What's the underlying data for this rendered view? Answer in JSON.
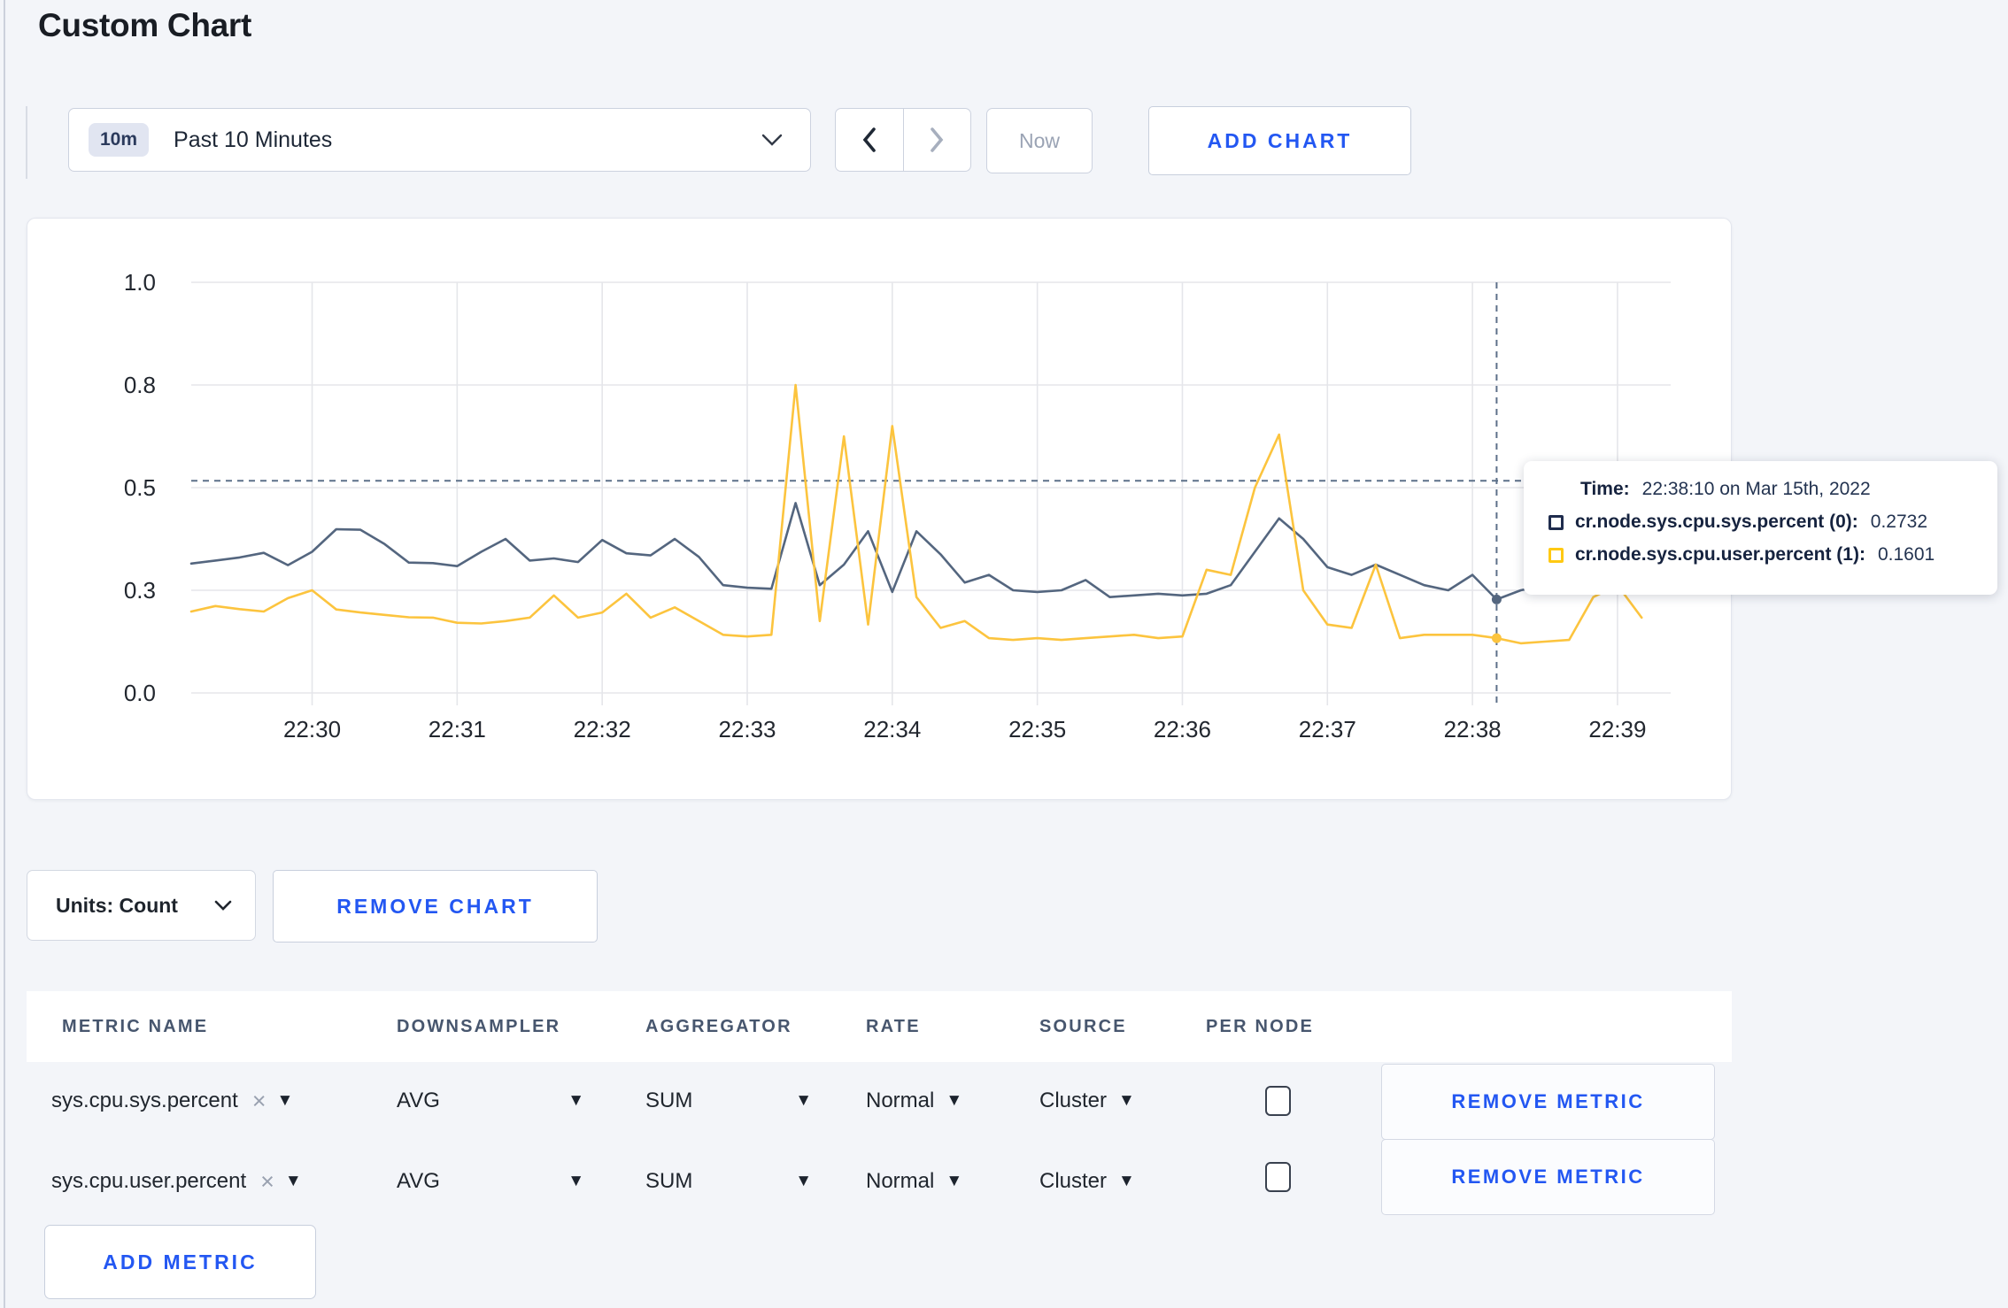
{
  "page": {
    "title": "Custom Chart"
  },
  "toolbar": {
    "range_badge": "10m",
    "range_label": "Past 10 Minutes",
    "now_label": "Now",
    "add_chart_label": "ADD CHART"
  },
  "controls": {
    "units_label": "Units: Count",
    "remove_chart_label": "REMOVE CHART",
    "add_metric_label": "ADD METRIC"
  },
  "tooltip": {
    "time_label": "Time:",
    "time_value": "22:38:10 on Mar 15th, 2022",
    "rows": [
      {
        "label": "cr.node.sys.cpu.sys.percent (0):",
        "value": "0.2732",
        "color": "#1f2c4d"
      },
      {
        "label": "cr.node.sys.cpu.user.percent (1):",
        "value": "0.1601",
        "color": "#ffc913"
      }
    ]
  },
  "table": {
    "headers": [
      "METRIC NAME",
      "DOWNSAMPLER",
      "AGGREGATOR",
      "RATE",
      "SOURCE",
      "PER NODE"
    ],
    "remove_metric_label": "REMOVE METRIC",
    "rows": [
      {
        "metric": "sys.cpu.sys.percent",
        "remove_x": "×",
        "downsampler": "AVG",
        "aggregator": "SUM",
        "rate": "Normal",
        "source": "Cluster",
        "per_node_checked": false
      },
      {
        "metric": "sys.cpu.user.percent",
        "remove_x": "×",
        "downsampler": "AVG",
        "aggregator": "SUM",
        "rate": "Normal",
        "source": "Cluster",
        "per_node_checked": false
      }
    ]
  },
  "chart_data": {
    "type": "line",
    "title": "",
    "x_start_time": "22:29:10",
    "x_step_seconds": 10,
    "x_domain_seconds": [
      0,
      612
    ],
    "x_ticks": [
      {
        "s": 50,
        "label": "22:30"
      },
      {
        "s": 110,
        "label": "22:31"
      },
      {
        "s": 170,
        "label": "22:32"
      },
      {
        "s": 230,
        "label": "22:33"
      },
      {
        "s": 290,
        "label": "22:34"
      },
      {
        "s": 350,
        "label": "22:35"
      },
      {
        "s": 410,
        "label": "22:36"
      },
      {
        "s": 470,
        "label": "22:37"
      },
      {
        "s": 530,
        "label": "22:38"
      },
      {
        "s": 590,
        "label": "22:39"
      }
    ],
    "y_axis": {
      "stops": [
        0,
        0.3,
        0.5,
        0.8,
        1.0
      ],
      "labels": [
        "0.0",
        "0.3",
        "0.5",
        "0.8",
        "1.0"
      ]
    },
    "grid": true,
    "legend_position": "tooltip",
    "series": [
      {
        "name": "cr.node.sys.cpu.sys.percent (0)",
        "color": "#54667f",
        "values": [
          0.352,
          0.358,
          0.364,
          0.373,
          0.349,
          0.375,
          0.419,
          0.418,
          0.39,
          0.354,
          0.353,
          0.347,
          0.375,
          0.4,
          0.358,
          0.362,
          0.355,
          0.398,
          0.372,
          0.368,
          0.4,
          0.365,
          0.31,
          0.305,
          0.303,
          0.47,
          0.31,
          0.35,
          0.415,
          0.295,
          0.415,
          0.37,
          0.315,
          0.33,
          0.3,
          0.295,
          0.3,
          0.32,
          0.28,
          0.285,
          0.29,
          0.285,
          0.29,
          0.31,
          0.375,
          0.44,
          0.4,
          0.345,
          0.33,
          0.35,
          0.33,
          0.31,
          0.3,
          0.33,
          0.2732,
          0.3,
          0.31,
          0.325,
          0.3,
          0.295,
          0.305
        ]
      },
      {
        "name": "cr.node.sys.cpu.user.percent (1)",
        "color": "#fcc43e",
        "values": [
          0.238,
          0.254,
          0.245,
          0.238,
          0.277,
          0.3,
          0.244,
          0.235,
          0.228,
          0.221,
          0.22,
          0.205,
          0.203,
          0.21,
          0.22,
          0.285,
          0.22,
          0.235,
          0.29,
          0.22,
          0.25,
          0.21,
          0.17,
          0.165,
          0.17,
          0.8,
          0.21,
          0.65,
          0.2,
          0.68,
          0.28,
          0.19,
          0.21,
          0.16,
          0.155,
          0.16,
          0.155,
          0.16,
          0.165,
          0.17,
          0.16,
          0.165,
          0.34,
          0.33,
          0.5,
          0.655,
          0.3,
          0.2,
          0.19,
          0.35,
          0.16,
          0.17,
          0.17,
          0.17,
          0.1601,
          0.145,
          0.15,
          0.155,
          0.28,
          0.31,
          0.22
        ]
      }
    ],
    "crosshair": {
      "x_seconds": 540,
      "y_value": 0.52,
      "point_values": [
        0.2732,
        0.1601
      ]
    },
    "style": {
      "grid_color": "#e5e6ea",
      "axis_text_color": "#22272f",
      "crosshair_color": "#5d7089"
    }
  }
}
